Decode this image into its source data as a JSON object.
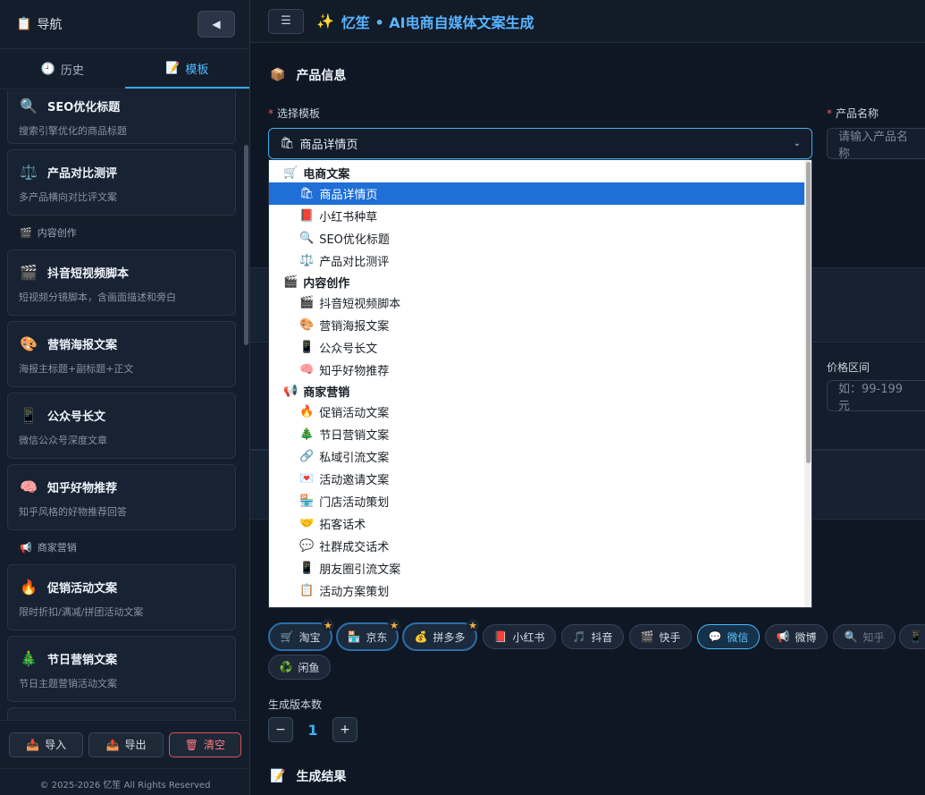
{
  "sidebar": {
    "title": "导航",
    "title_icon": "📋",
    "collapse_icon": "◀",
    "tabs": [
      {
        "icon": "🕘",
        "label": "历史"
      },
      {
        "icon": "📝",
        "label": "模板"
      }
    ],
    "cards": [
      {
        "icon": "🔍",
        "name": "SEO优化标题",
        "desc": "搜索引擎优化的商品标题"
      },
      {
        "icon": "⚖️",
        "name": "产品对比测评",
        "desc": "多产品横向对比评文案"
      }
    ],
    "cat_content": {
      "icon": "🎬",
      "label": "内容创作"
    },
    "cards2": [
      {
        "icon": "🎬",
        "name": "抖音短视频脚本",
        "desc": "短视频分镜脚本，含画面描述和旁白"
      },
      {
        "icon": "🎨",
        "name": "营销海报文案",
        "desc": "海报主标题+副标题+正文"
      },
      {
        "icon": "📱",
        "name": "公众号长文",
        "desc": "微信公众号深度文章"
      },
      {
        "icon": "🧠",
        "name": "知乎好物推荐",
        "desc": "知乎风格的好物推荐回答"
      }
    ],
    "cat_merchant": {
      "icon": "📢",
      "label": "商家营销"
    },
    "cards3": [
      {
        "icon": "🔥",
        "name": "促销活动文案",
        "desc": "限时折扣/满减/拼团活动文案"
      },
      {
        "icon": "🎄",
        "name": "节日营销文案",
        "desc": "节日主题营销活动文案"
      }
    ],
    "actions": [
      {
        "icon": "📥",
        "label": "导入"
      },
      {
        "icon": "📤",
        "label": "导出"
      },
      {
        "icon": "🗑",
        "label": "清空"
      }
    ],
    "footer": "© 2025-2026 忆笙 All Rights Reserved"
  },
  "topbar": {
    "menu_icon": "☰",
    "title_icon": "✨",
    "title": "忆笙 • AI电商自媒体文案生成"
  },
  "main": {
    "section_product": {
      "icon": "📦",
      "title": "产品信息"
    },
    "template_label": "选择模板",
    "template_selected": {
      "icon": "🛍",
      "label": "商品详情页"
    },
    "product_name_label": "产品名称",
    "product_name_placeholder": "请输入产品名称",
    "price_label": "价格区间",
    "price_placeholder": "如：99-199元",
    "versions_label": "生成版本数",
    "versions_value": "1",
    "section_result": {
      "icon": "📝",
      "title": "生成结果"
    }
  },
  "dropdown": {
    "groups": [
      {
        "icon": "🛒",
        "label": "电商文案",
        "items": [
          {
            "icon": "🛍",
            "label": "商品详情页",
            "selected": true
          },
          {
            "icon": "📕",
            "label": "小红书种草"
          },
          {
            "icon": "🔍",
            "label": "SEO优化标题"
          },
          {
            "icon": "⚖️",
            "label": "产品对比测评"
          }
        ]
      },
      {
        "icon": "🎬",
        "label": "内容创作",
        "items": [
          {
            "icon": "🎬",
            "label": "抖音短视频脚本"
          },
          {
            "icon": "🎨",
            "label": "营销海报文案"
          },
          {
            "icon": "📱",
            "label": "公众号长文"
          },
          {
            "icon": "🧠",
            "label": "知乎好物推荐"
          }
        ]
      },
      {
        "icon": "📢",
        "label": "商家营销",
        "items": [
          {
            "icon": "🔥",
            "label": "促销活动文案"
          },
          {
            "icon": "🎄",
            "label": "节日营销文案"
          },
          {
            "icon": "🔗",
            "label": "私域引流文案"
          },
          {
            "icon": "💌",
            "label": "活动邀请文案"
          },
          {
            "icon": "🏪",
            "label": "门店活动策划"
          },
          {
            "icon": "🤝",
            "label": "拓客话术"
          },
          {
            "icon": "💬",
            "label": "社群成交话术"
          },
          {
            "icon": "📱",
            "label": "朋友圈引流文案"
          },
          {
            "icon": "📋",
            "label": "活动方案策划"
          }
        ]
      }
    ]
  },
  "platforms": [
    {
      "icon": "🛒",
      "label": "淘宝",
      "starred": true
    },
    {
      "icon": "🏪",
      "label": "京东",
      "starred": true
    },
    {
      "icon": "💰",
      "label": "拼多多",
      "starred": true
    },
    {
      "icon": "📕",
      "label": "小红书"
    },
    {
      "icon": "🎵",
      "label": "抖音"
    },
    {
      "icon": "🎬",
      "label": "快手"
    },
    {
      "icon": "💬",
      "label": "微信"
    },
    {
      "icon": "📢",
      "label": "微博"
    },
    {
      "icon": "🔍",
      "label": "知乎"
    },
    {
      "icon": "📱",
      "label": ""
    },
    {
      "icon": "♻️",
      "label": "闲鱼"
    }
  ]
}
